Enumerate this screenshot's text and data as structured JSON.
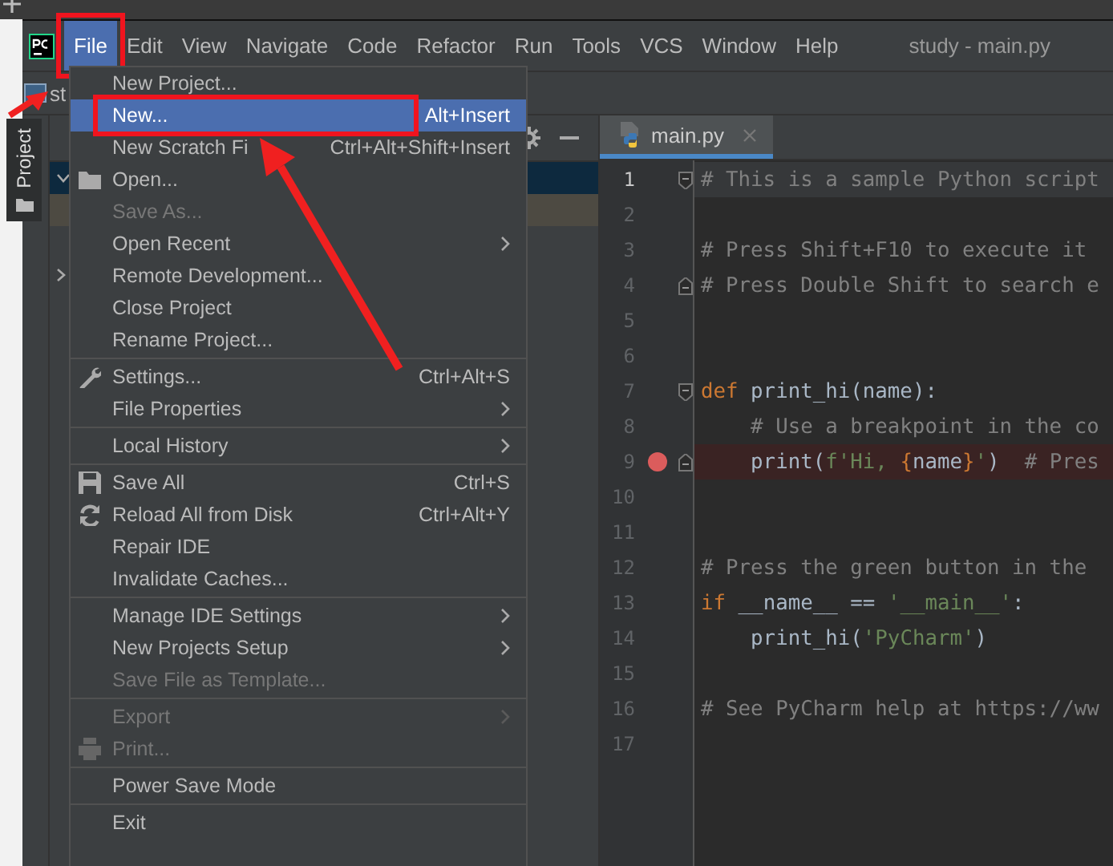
{
  "menubar": {
    "items": [
      {
        "label": "File",
        "selected": true,
        "highlighted": true
      },
      {
        "label": "Edit",
        "selected": false,
        "highlighted": false
      },
      {
        "label": "View",
        "selected": false,
        "highlighted": false
      },
      {
        "label": "Navigate",
        "selected": false,
        "highlighted": false
      },
      {
        "label": "Code",
        "selected": false,
        "highlighted": false
      },
      {
        "label": "Refactor",
        "selected": false,
        "highlighted": false
      },
      {
        "label": "Run",
        "selected": false,
        "highlighted": false
      },
      {
        "label": "Tools",
        "selected": false,
        "highlighted": false
      },
      {
        "label": "VCS",
        "selected": false,
        "highlighted": false
      },
      {
        "label": "Window",
        "selected": false,
        "highlighted": false
      },
      {
        "label": "Help",
        "selected": false,
        "highlighted": false
      }
    ],
    "title": "study - main.py"
  },
  "toolbar": {
    "project_label": "st"
  },
  "tool_window": {
    "tab": "Project"
  },
  "editor": {
    "tabs": [
      {
        "label": "main.py",
        "selected": true
      }
    ],
    "lines": [
      {
        "number": "1",
        "current": true,
        "breakpoint": false,
        "fold_start": true,
        "fold_end": false,
        "segments": [
          {
            "kind": "comment",
            "text": "# This is a sample Python script"
          }
        ]
      },
      {
        "number": "2",
        "current": false,
        "breakpoint": false,
        "fold_start": false,
        "fold_end": false
      },
      {
        "number": "3",
        "current": false,
        "breakpoint": false,
        "fold_start": false,
        "fold_end": false,
        "segments": [
          {
            "kind": "comment",
            "text": "# Press Shift+F10 to execute it"
          }
        ]
      },
      {
        "number": "4",
        "current": false,
        "breakpoint": false,
        "fold_start": false,
        "fold_end": true,
        "segments": [
          {
            "kind": "comment",
            "text": "# Press Double Shift to search e"
          }
        ]
      },
      {
        "number": "5",
        "current": false,
        "breakpoint": false,
        "fold_start": false,
        "fold_end": false
      },
      {
        "number": "6",
        "current": false,
        "breakpoint": false,
        "fold_start": false,
        "fold_end": false
      },
      {
        "number": "7",
        "current": false,
        "breakpoint": false,
        "fold_start": true,
        "fold_end": false,
        "segments": [
          {
            "kind": "keyword",
            "text": "def "
          },
          {
            "kind": "plain",
            "text": "print_hi(name):"
          }
        ]
      },
      {
        "number": "8",
        "current": false,
        "breakpoint": false,
        "fold_start": false,
        "fold_end": false,
        "segments": [
          {
            "kind": "comment",
            "text": "    # Use a breakpoint in the co"
          }
        ]
      },
      {
        "number": "9",
        "current": false,
        "breakpoint": true,
        "fold_start": false,
        "fold_end": true,
        "segments": [
          {
            "kind": "plain",
            "text": "    print("
          },
          {
            "kind": "string",
            "text": "f'Hi, "
          },
          {
            "kind": "keyword",
            "text": "{"
          },
          {
            "kind": "plain",
            "text": "name"
          },
          {
            "kind": "keyword",
            "text": "}"
          },
          {
            "kind": "string",
            "text": "'"
          },
          {
            "kind": "plain",
            "text": ")  "
          },
          {
            "kind": "comment",
            "text": "# Pres"
          }
        ]
      },
      {
        "number": "10",
        "current": false,
        "breakpoint": false,
        "fold_start": false,
        "fold_end": false
      },
      {
        "number": "11",
        "current": false,
        "breakpoint": false,
        "fold_start": false,
        "fold_end": false
      },
      {
        "number": "12",
        "current": false,
        "breakpoint": false,
        "fold_start": false,
        "fold_end": false,
        "segments": [
          {
            "kind": "comment",
            "text": "# Press the green button in the"
          }
        ]
      },
      {
        "number": "13",
        "current": false,
        "breakpoint": false,
        "fold_start": false,
        "fold_end": false,
        "segments": [
          {
            "kind": "keyword",
            "text": "if "
          },
          {
            "kind": "plain",
            "text": "__name__ == "
          },
          {
            "kind": "string",
            "text": "'__main__'"
          },
          {
            "kind": "plain",
            "text": ":"
          }
        ]
      },
      {
        "number": "14",
        "current": false,
        "breakpoint": false,
        "fold_start": false,
        "fold_end": false,
        "segments": [
          {
            "kind": "plain",
            "text": "    print_hi("
          },
          {
            "kind": "string",
            "text": "'PyCharm'"
          },
          {
            "kind": "plain",
            "text": ")"
          }
        ]
      },
      {
        "number": "15",
        "current": false,
        "breakpoint": false,
        "fold_start": false,
        "fold_end": false
      },
      {
        "number": "16",
        "current": false,
        "breakpoint": false,
        "fold_start": false,
        "fold_end": false,
        "segments": [
          {
            "kind": "comment",
            "text": "# See PyCharm help at https://ww"
          }
        ]
      },
      {
        "number": "17",
        "current": false,
        "breakpoint": false,
        "fold_start": false,
        "fold_end": false
      }
    ]
  },
  "file_menu": {
    "items": [
      {
        "kind": "item",
        "label": "New Project...",
        "disabled": false,
        "selected": false,
        "highlighted": false
      },
      {
        "kind": "item",
        "label": "New...",
        "shortcut": "Alt+Insert",
        "disabled": false,
        "selected": true,
        "highlighted": true
      },
      {
        "kind": "item",
        "label": "New Scratch Fi",
        "shortcut": "Ctrl+Alt+Shift+Insert",
        "disabled": false,
        "selected": false,
        "highlighted": false
      },
      {
        "kind": "item",
        "label": "Open...",
        "disabled": false,
        "selected": false,
        "highlighted": false
      },
      {
        "kind": "item",
        "label": "Save As...",
        "disabled": true,
        "selected": false,
        "highlighted": false
      },
      {
        "kind": "item",
        "label": "Open Recent",
        "submenu": true,
        "disabled": false,
        "selected": false,
        "highlighted": false
      },
      {
        "kind": "item",
        "label": "Remote Development...",
        "disabled": false,
        "selected": false,
        "highlighted": false
      },
      {
        "kind": "item",
        "label": "Close Project",
        "disabled": false,
        "selected": false,
        "highlighted": false
      },
      {
        "kind": "item",
        "label": "Rename Project...",
        "disabled": false,
        "selected": false,
        "highlighted": false
      },
      {
        "kind": "separator"
      },
      {
        "kind": "item",
        "label": "Settings...",
        "shortcut": "Ctrl+Alt+S",
        "disabled": false,
        "selected": false,
        "highlighted": false
      },
      {
        "kind": "item",
        "label": "File Properties",
        "submenu": true,
        "disabled": false,
        "selected": false,
        "highlighted": false
      },
      {
        "kind": "separator"
      },
      {
        "kind": "item",
        "label": "Local History",
        "submenu": true,
        "disabled": false,
        "selected": false,
        "highlighted": false
      },
      {
        "kind": "separator"
      },
      {
        "kind": "item",
        "label": "Save All",
        "shortcut": "Ctrl+S",
        "disabled": false,
        "selected": false,
        "highlighted": false
      },
      {
        "kind": "item",
        "label": "Reload All from Disk",
        "shortcut": "Ctrl+Alt+Y",
        "disabled": false,
        "selected": false,
        "highlighted": false
      },
      {
        "kind": "item",
        "label": "Repair IDE",
        "disabled": false,
        "selected": false,
        "highlighted": false
      },
      {
        "kind": "item",
        "label": "Invalidate Caches...",
        "disabled": false,
        "selected": false,
        "highlighted": false
      },
      {
        "kind": "separator"
      },
      {
        "kind": "item",
        "label": "Manage IDE Settings",
        "submenu": true,
        "disabled": false,
        "selected": false,
        "highlighted": false
      },
      {
        "kind": "item",
        "label": "New Projects Setup",
        "submenu": true,
        "disabled": false,
        "selected": false,
        "highlighted": false
      },
      {
        "kind": "item",
        "label": "Save File as Template...",
        "disabled": true,
        "selected": false,
        "highlighted": false
      },
      {
        "kind": "separator"
      },
      {
        "kind": "item",
        "label": "Export",
        "submenu": true,
        "disabled": true,
        "selected": false,
        "highlighted": false
      },
      {
        "kind": "item",
        "label": "Print...",
        "disabled": true,
        "selected": false,
        "highlighted": false
      },
      {
        "kind": "separator"
      },
      {
        "kind": "item",
        "label": "Power Save Mode",
        "disabled": false,
        "selected": false,
        "highlighted": false
      },
      {
        "kind": "separator"
      },
      {
        "kind": "item",
        "label": "Exit",
        "disabled": false,
        "selected": false,
        "highlighted": false
      }
    ]
  },
  "annotation": {
    "arrows": true
  }
}
